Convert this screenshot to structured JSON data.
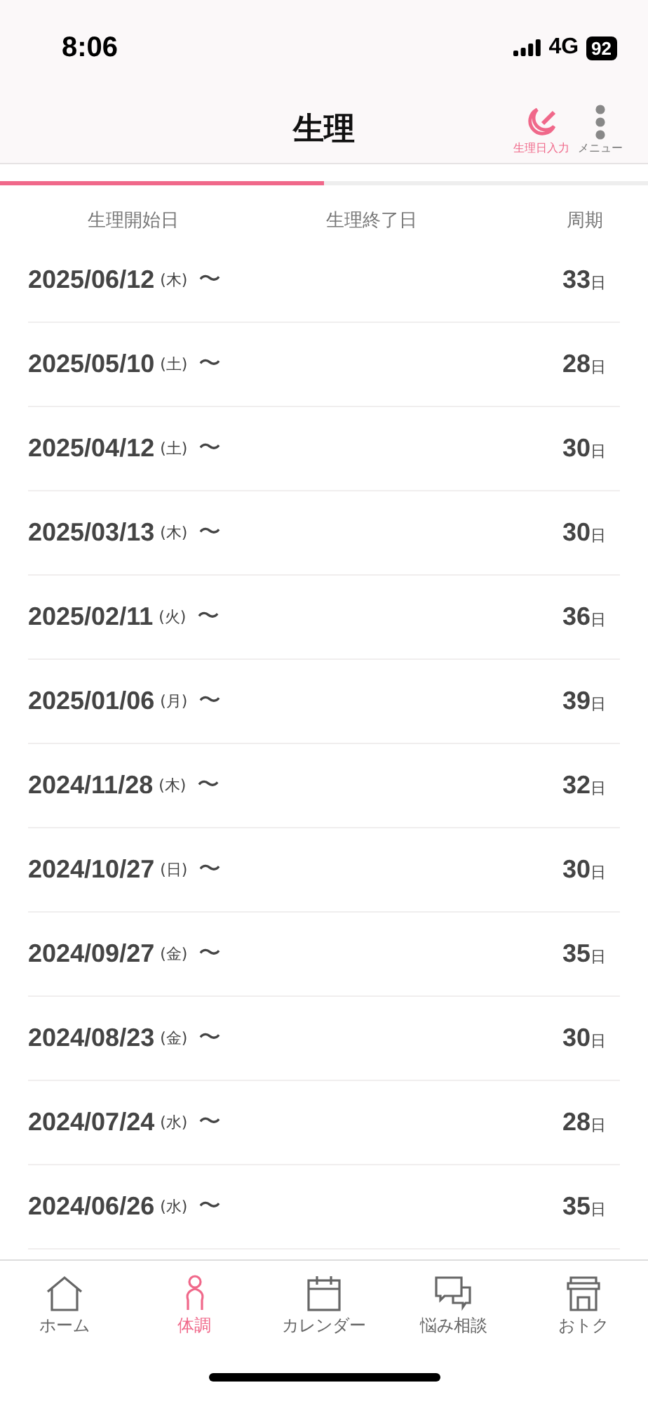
{
  "status_bar": {
    "time": "8:06",
    "network": "4G",
    "battery": "92"
  },
  "header": {
    "title": "生理",
    "actions": [
      {
        "kind": "pen",
        "label": "生理日入力",
        "selected": true
      },
      {
        "kind": "dots",
        "label": "メニュー",
        "selected": false
      }
    ]
  },
  "progress": {
    "level": 0.5
  },
  "table": {
    "columns": [
      "生理開始日",
      "生理終了日",
      "周期"
    ],
    "rows": [
      {
        "start": "2025/06/12",
        "weekday": "(木)",
        "separator": "〜",
        "cycle": "33",
        "unit": "日"
      },
      {
        "start": "2025/05/10",
        "weekday": "(土)",
        "separator": "〜",
        "cycle": "28",
        "unit": "日"
      },
      {
        "start": "2025/04/12",
        "weekday": "(土)",
        "separator": "〜",
        "cycle": "30",
        "unit": "日"
      },
      {
        "start": "2025/03/13",
        "weekday": "(木)",
        "separator": "〜",
        "cycle": "30",
        "unit": "日"
      },
      {
        "start": "2025/02/11",
        "weekday": "(火)",
        "separator": "〜",
        "cycle": "36",
        "unit": "日"
      },
      {
        "start": "2025/01/06",
        "weekday": "(月)",
        "separator": "〜",
        "cycle": "39",
        "unit": "日"
      },
      {
        "start": "2024/11/28",
        "weekday": "(木)",
        "separator": "〜",
        "cycle": "32",
        "unit": "日"
      },
      {
        "start": "2024/10/27",
        "weekday": "(日)",
        "separator": "〜",
        "cycle": "30",
        "unit": "日"
      },
      {
        "start": "2024/09/27",
        "weekday": "(金)",
        "separator": "〜",
        "cycle": "35",
        "unit": "日"
      },
      {
        "start": "2024/08/23",
        "weekday": "(金)",
        "separator": "〜",
        "cycle": "30",
        "unit": "日"
      },
      {
        "start": "2024/07/24",
        "weekday": "(水)",
        "separator": "〜",
        "cycle": "28",
        "unit": "日"
      },
      {
        "start": "2024/06/26",
        "weekday": "(水)",
        "separator": "〜",
        "cycle": "35",
        "unit": "日"
      }
    ]
  },
  "tab_bar": [
    {
      "kind": "home",
      "label": "ホーム",
      "selected": false
    },
    {
      "kind": "body",
      "label": "体調",
      "selected": true
    },
    {
      "kind": "calendar",
      "label": "カレンダー",
      "selected": false
    },
    {
      "kind": "chat",
      "label": "悩み相談",
      "selected": false
    },
    {
      "kind": "shop",
      "label": "おトク",
      "selected": false
    }
  ]
}
